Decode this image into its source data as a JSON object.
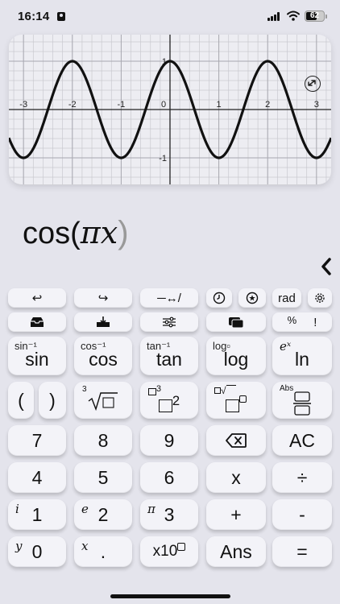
{
  "status": {
    "time": "16:14",
    "battery": "62",
    "battery_level": 0.62
  },
  "graph": {
    "function": "cos(pi*x)",
    "x_range": [
      -3.3,
      3.3
    ],
    "y_range": [
      -1.55,
      1.55
    ],
    "x_tick_labels": [
      "-3",
      "-2",
      "-1",
      "0",
      "1",
      "2",
      "3"
    ],
    "y_tick_labels": [
      "1",
      "-1"
    ],
    "icons": {
      "fullscreen": "expand-arrows-icon"
    }
  },
  "expression": {
    "fn": "cos",
    "open": "(",
    "arg": "πx",
    "close": ")"
  },
  "toolbar": {
    "undo": "↩",
    "redo": "↪",
    "cursor": "─↔/",
    "history": "clock-icon",
    "favorite": "star-icon",
    "angle_mode": "rad",
    "settings": "gear-icon"
  },
  "row2": {
    "import": "tray-in-icon",
    "export": "tray-out-icon",
    "adjust": "sliders-icon",
    "tabs": "cards-icon",
    "percent": "%",
    "factorial": "!"
  },
  "trig": [
    {
      "top": "sin⁻¹",
      "main": "sin"
    },
    {
      "top": "cos⁻¹",
      "main": "cos"
    },
    {
      "top": "tan⁻¹",
      "main": "tan"
    },
    {
      "top": "log▫",
      "main": "log"
    },
    {
      "top": "eˣ",
      "main": "ln"
    }
  ],
  "paren": {
    "open": "(",
    "close": ")"
  },
  "special": {
    "cbrt_top": "3",
    "power_top": "3",
    "power_main": "2",
    "nthroot_top": "▫",
    "abs_top": "Abs"
  },
  "digits": {
    "row1": [
      "7",
      "8",
      "9",
      "⌫",
      "AC"
    ],
    "row2": [
      "4",
      "5",
      "6",
      "x",
      "÷"
    ],
    "row3": [
      {
        "sup": "i",
        "main": "1"
      },
      {
        "sup": "e",
        "main": "2"
      },
      {
        "sup": "π",
        "main": "3"
      },
      {
        "sup": "",
        "main": "+"
      },
      {
        "sup": "",
        "main": "-"
      }
    ],
    "row4": [
      {
        "sup": "y",
        "main": "0"
      },
      {
        "sup": "x",
        "main": "."
      },
      {
        "sup": "",
        "main": "x10"
      },
      {
        "sup": "",
        "main": "Ans"
      },
      {
        "sup": "",
        "main": "="
      }
    ]
  }
}
